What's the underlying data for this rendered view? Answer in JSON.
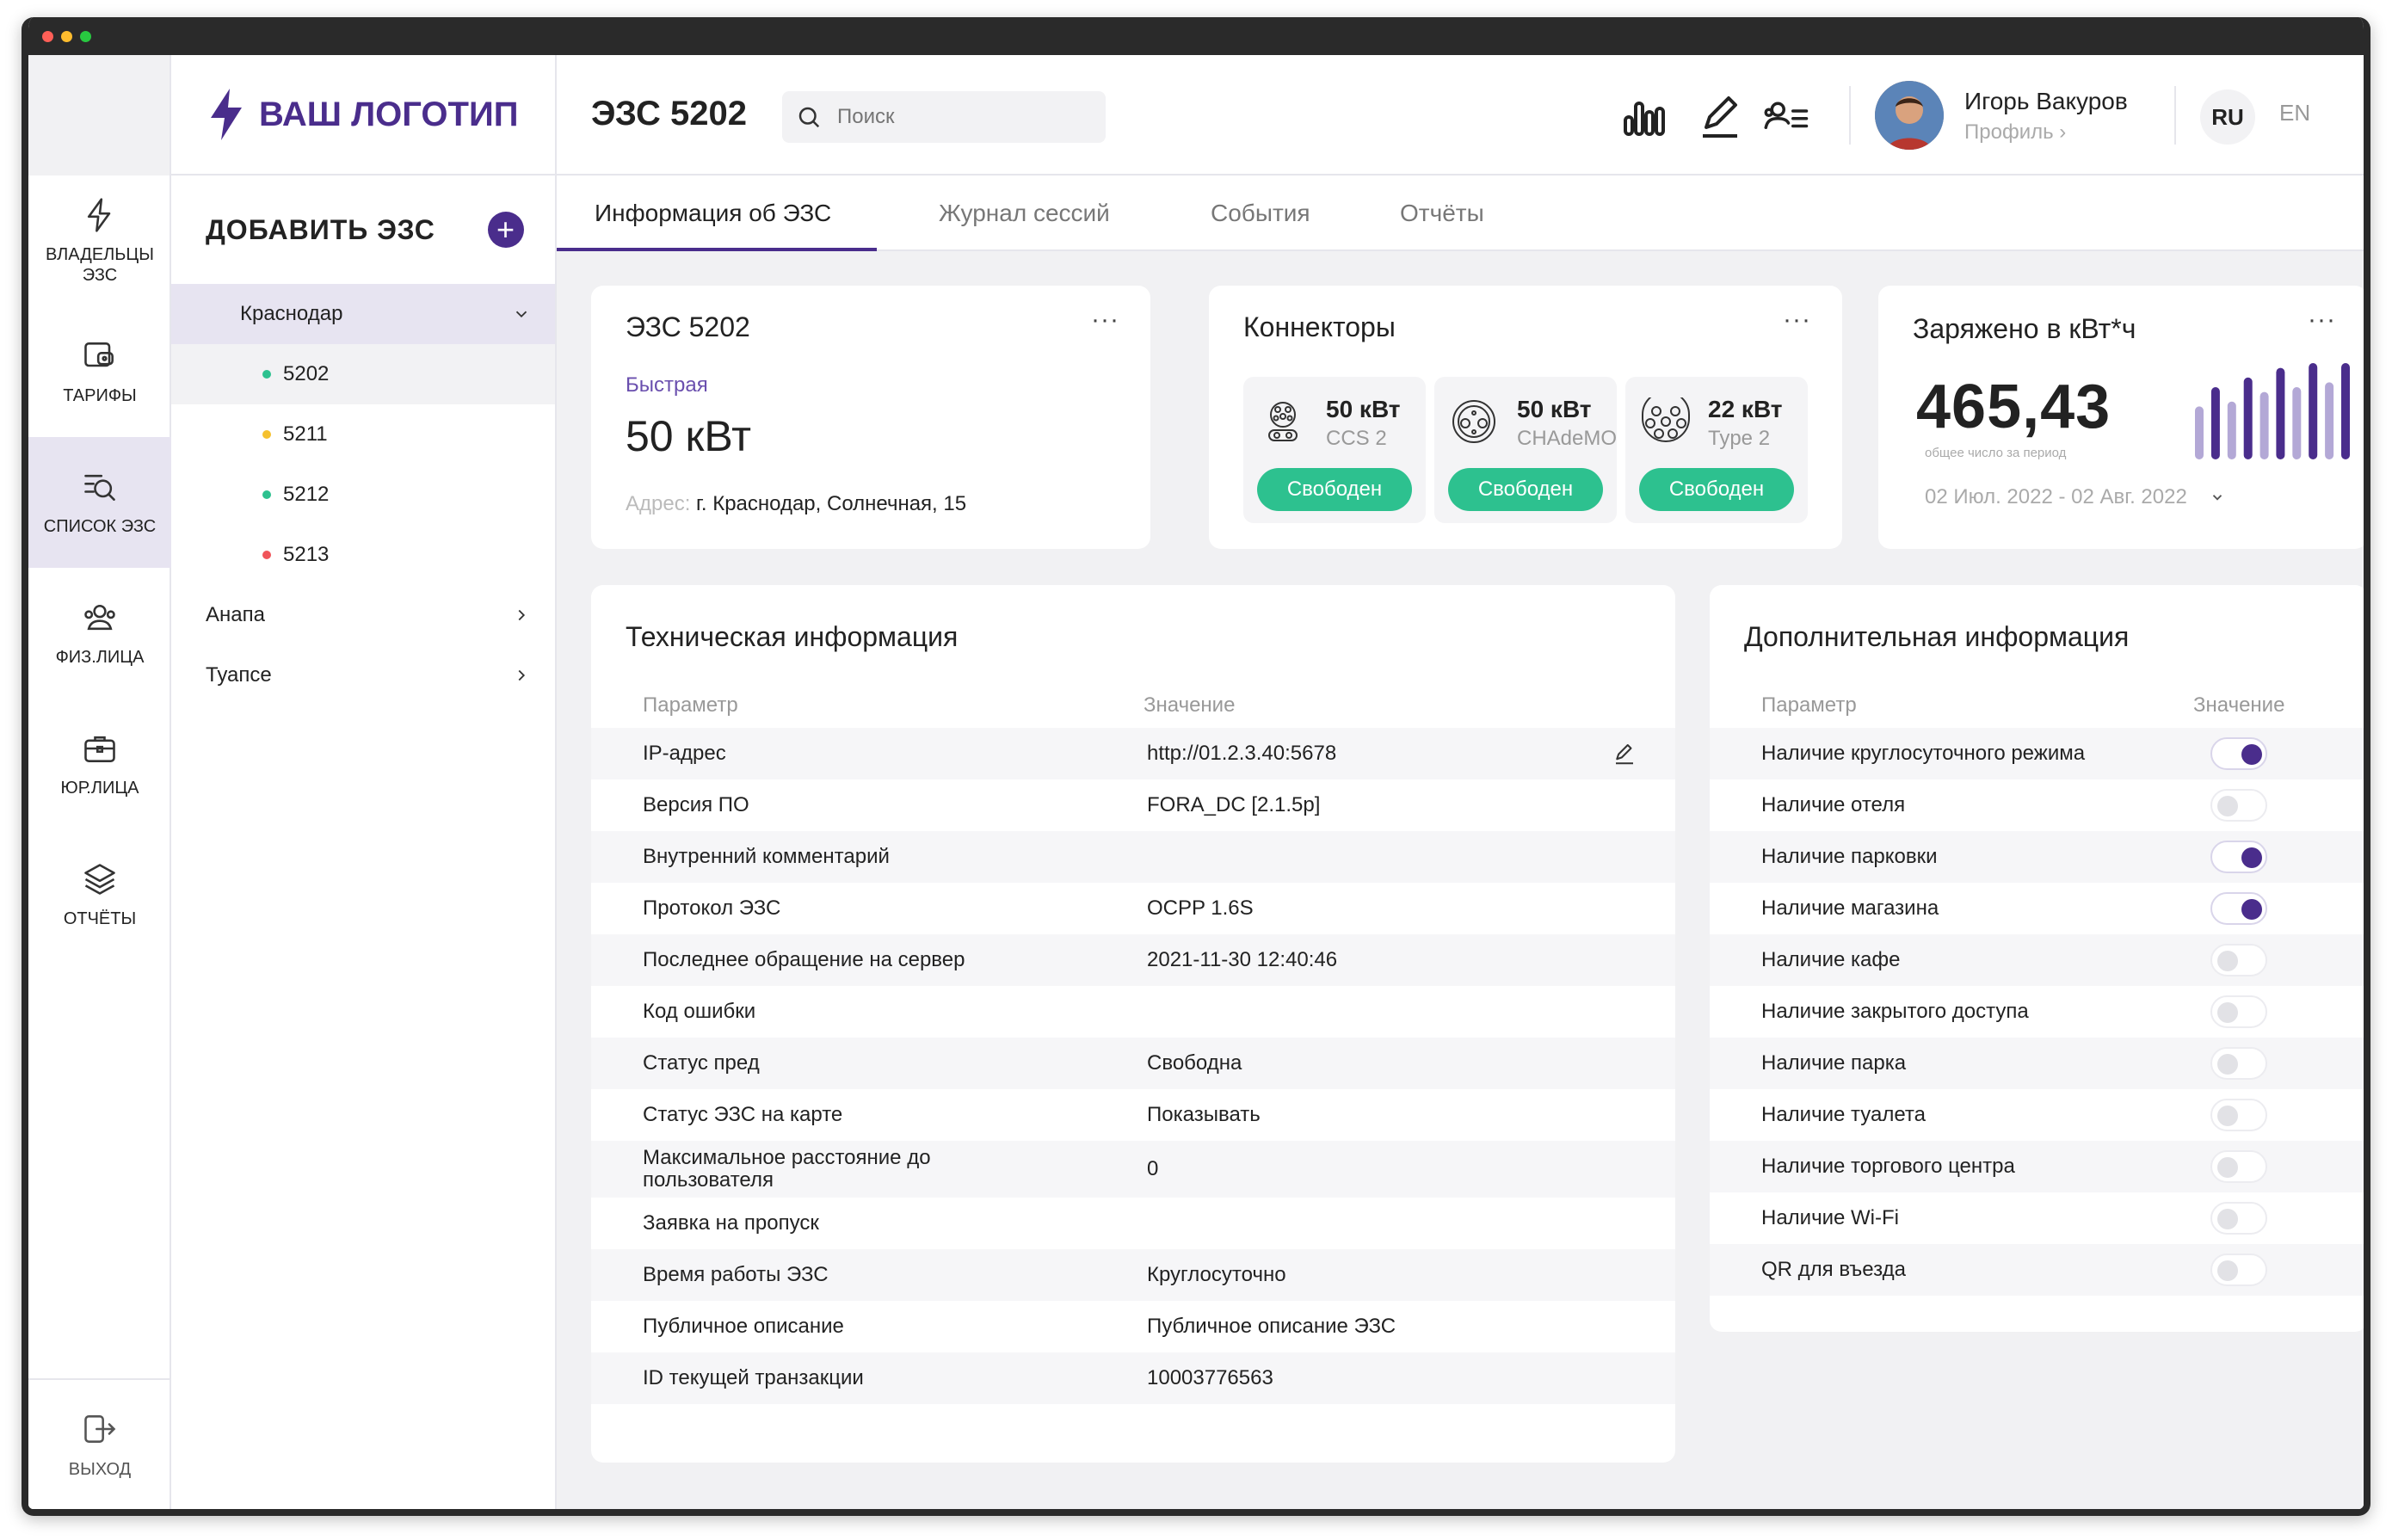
{
  "window": {
    "controls": [
      "close",
      "minimize",
      "maximize"
    ]
  },
  "brand": {
    "logo_text": "ВАШ ЛОГОТИП",
    "accent": "#4a2d8c",
    "success": "#2dc18f"
  },
  "rail": {
    "items": [
      {
        "label": "ВЛАДЕЛЬЦЫ ЭЗС",
        "icon": "bolt-icon"
      },
      {
        "label": "ТАРИФЫ",
        "icon": "wallet-icon"
      },
      {
        "label": "СПИСОК ЭЗС",
        "icon": "list-search-icon"
      },
      {
        "label": "ФИЗ.ЛИЦА",
        "icon": "users-icon"
      },
      {
        "label": "ЮР.ЛИЦА",
        "icon": "briefcase-icon"
      },
      {
        "label": "ОТЧЁТЫ",
        "icon": "layers-icon"
      }
    ],
    "exit_label": "ВЫХОД"
  },
  "tree": {
    "add_label": "ДОБАВИТЬ ЭЗС",
    "cities": [
      {
        "name": "Краснодар",
        "stations": [
          {
            "id": "5202",
            "status_color": "#2dc18f"
          },
          {
            "id": "5211",
            "status_color": "#f5c12e"
          },
          {
            "id": "5212",
            "status_color": "#2dc18f"
          },
          {
            "id": "5213",
            "status_color": "#f0555a"
          }
        ]
      },
      {
        "name": "Анапа"
      },
      {
        "name": "Туапсе"
      }
    ]
  },
  "header": {
    "title": "ЭЗС 5202",
    "search_placeholder": "Поиск",
    "user_name": "Игорь Вакуров",
    "user_profile": "Профиль ›",
    "lang_ru": "RU",
    "lang_en": "EN"
  },
  "tabs": [
    "Информация об ЭЗС",
    "Журнал сессий",
    "События",
    "Отчёты"
  ],
  "station_card": {
    "title": "ЭЗС 5202",
    "type": "Быстрая",
    "power": "50 кВт",
    "address_label": "Адрес:",
    "address": "г. Краснодар, Солнечная, 15"
  },
  "connectors": {
    "title": "Коннекторы",
    "items": [
      {
        "power": "50 кВт",
        "type": "CCS 2",
        "status": "Свободен",
        "icon": "ccs2-connector-icon"
      },
      {
        "power": "50 кВт",
        "type": "CHAdeMO",
        "status": "Свободен",
        "icon": "chademo-connector-icon"
      },
      {
        "power": "22 кВт",
        "type": "Type 2",
        "status": "Свободен",
        "icon": "type2-connector-icon"
      }
    ]
  },
  "charged": {
    "title": "Заряжено в кВт*ч",
    "value": "465,43",
    "caption": "общее число за период",
    "period": "02 Июл. 2022 - 02 Авг. 2022"
  },
  "chart_data": {
    "type": "bar",
    "values": [
      55,
      75,
      60,
      85,
      70,
      95,
      75,
      100,
      80,
      100
    ],
    "colors": [
      "#b3a8d6",
      "#4a2d8c"
    ]
  },
  "tech": {
    "title": "Техническая информация",
    "col_param": "Параметр",
    "col_value": "Значение",
    "rows": [
      {
        "param": "IP-адрес",
        "value": "http://01.2.3.40:5678"
      },
      {
        "param": "Версия ПО",
        "value": "FORA_DC [2.1.5p]"
      },
      {
        "param": "Внутренний комментарий",
        "value": ""
      },
      {
        "param": "Протокол ЭЗС",
        "value": "OCPP 1.6S"
      },
      {
        "param": "Последнее обращение на сервер",
        "value": "2021-11-30 12:40:46"
      },
      {
        "param": "Код ошибки",
        "value": ""
      },
      {
        "param": "Статус пред",
        "value": "Свободна"
      },
      {
        "param": "Статус ЭЗС на карте",
        "value": "Показывать"
      },
      {
        "param": "Максимальное расстояние до пользователя",
        "value": "0"
      },
      {
        "param": "Заявка на пропуск",
        "value": ""
      },
      {
        "param": "Время работы ЭЗС",
        "value": "Круглосуточно"
      },
      {
        "param": "Публичное описание",
        "value": "Публичное описание ЭЗС"
      },
      {
        "param": "ID текущей транзакции",
        "value": "10003776563"
      }
    ]
  },
  "extra": {
    "title": "Дополнительная информация",
    "col_param": "Параметр",
    "col_value": "Значение",
    "rows": [
      {
        "param": "Наличие круглосуточного режима",
        "on": true
      },
      {
        "param": "Наличие отеля",
        "on": false
      },
      {
        "param": "Наличие парковки",
        "on": true
      },
      {
        "param": "Наличие магазина",
        "on": true
      },
      {
        "param": "Наличие кафе",
        "on": false
      },
      {
        "param": "Наличие закрытого доступа",
        "on": false
      },
      {
        "param": "Наличие парка",
        "on": false
      },
      {
        "param": "Наличие туалета",
        "on": false
      },
      {
        "param": "Наличие торгового центра",
        "on": false
      },
      {
        "param": "Наличие Wi-Fi",
        "on": false
      },
      {
        "param": "QR для въезда",
        "on": false
      }
    ]
  }
}
